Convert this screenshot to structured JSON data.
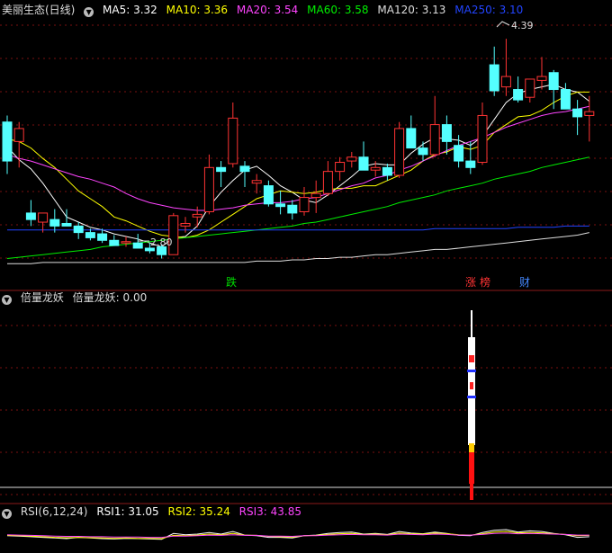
{
  "main_panel": {
    "title": "美丽生态(日线)",
    "ma": [
      {
        "label": "MA5: 3.32",
        "color": "#ffffff"
      },
      {
        "label": "MA10: 3.36",
        "color": "#ffff00"
      },
      {
        "label": "MA20: 3.54",
        "color": "#ff44ff"
      },
      {
        "label": "MA60: 3.58",
        "color": "#00ee00"
      },
      {
        "label": "MA120: 3.13",
        "color": "#dddddd"
      },
      {
        "label": "MA250: 3.10",
        "color": "#2244ff"
      }
    ],
    "high_label": "4.39",
    "low_label": "2.80",
    "events": [
      {
        "text": "跌",
        "color": "#00dd00",
        "bg": "#111111"
      },
      {
        "text": "涨",
        "color": "#ff3333",
        "bg": "#222222"
      },
      {
        "text": "榜",
        "color": "#ff3333",
        "bg": "#222222"
      },
      {
        "text": "财",
        "color": "#4488ff",
        "bg": "#111111"
      }
    ]
  },
  "mid_panel": {
    "title": "倍量龙妖",
    "value_label": "倍量龙妖: 0.00"
  },
  "rsi_panel": {
    "title": "RSI(6,12,24)",
    "rsi1_label": "RSI1: 31.05",
    "rsi2_label": "RSI2: 35.24",
    "rsi3_label": "RSI3: 43.85",
    "colors": {
      "rsi1": "#ffffff",
      "rsi2": "#ffff00",
      "rsi3": "#ff44ff"
    }
  },
  "chart_data": {
    "type": "candlestick",
    "y_range": [
      2.6,
      4.55
    ],
    "up_color": "#ff3333",
    "down_color": "#54ffff",
    "candles": [
      [
        3.75,
        3.8,
        3.35,
        3.45
      ],
      [
        3.6,
        3.75,
        3.4,
        3.7
      ],
      [
        3.05,
        3.15,
        2.95,
        3.0
      ],
      [
        2.98,
        3.05,
        2.9,
        3.05
      ],
      [
        3.0,
        3.08,
        2.9,
        2.95
      ],
      [
        2.97,
        3.08,
        2.95,
        2.95
      ],
      [
        2.95,
        2.98,
        2.85,
        2.9
      ],
      [
        2.9,
        2.93,
        2.84,
        2.86
      ],
      [
        2.89,
        2.93,
        2.82,
        2.84
      ],
      [
        2.84,
        2.88,
        2.8,
        2.8
      ],
      [
        2.82,
        2.87,
        2.79,
        2.83
      ],
      [
        2.82,
        2.89,
        2.8,
        2.78
      ],
      [
        2.78,
        2.82,
        2.74,
        2.76
      ],
      [
        2.79,
        2.81,
        2.7,
        2.73
      ],
      [
        2.73,
        3.05,
        2.73,
        3.03
      ],
      [
        2.95,
        3.02,
        2.9,
        2.97
      ],
      [
        3.02,
        3.1,
        2.94,
        3.04
      ],
      [
        3.06,
        3.5,
        3.04,
        3.4
      ],
      [
        3.4,
        3.45,
        3.25,
        3.37
      ],
      [
        3.43,
        3.9,
        3.4,
        3.78
      ],
      [
        3.41,
        3.45,
        3.25,
        3.37
      ],
      [
        3.28,
        3.35,
        3.2,
        3.3
      ],
      [
        3.26,
        3.3,
        3.1,
        3.12
      ],
      [
        3.12,
        3.22,
        3.04,
        3.1
      ],
      [
        3.11,
        3.15,
        3.0,
        3.05
      ],
      [
        3.06,
        3.25,
        3.03,
        3.17
      ],
      [
        3.17,
        3.3,
        3.05,
        3.2
      ],
      [
        3.2,
        3.45,
        3.18,
        3.37
      ],
      [
        3.37,
        3.48,
        3.3,
        3.44
      ],
      [
        3.45,
        3.52,
        3.4,
        3.48
      ],
      [
        3.48,
        3.6,
        3.4,
        3.38
      ],
      [
        3.38,
        3.45,
        3.33,
        3.4
      ],
      [
        3.4,
        3.43,
        3.3,
        3.34
      ],
      [
        3.34,
        3.75,
        3.32,
        3.7
      ],
      [
        3.7,
        3.8,
        3.6,
        3.55
      ],
      [
        3.55,
        3.6,
        3.45,
        3.5
      ],
      [
        3.5,
        3.95,
        3.48,
        3.73
      ],
      [
        3.73,
        3.8,
        3.5,
        3.6
      ],
      [
        3.57,
        3.65,
        3.4,
        3.45
      ],
      [
        3.45,
        3.6,
        3.35,
        3.4
      ],
      [
        3.44,
        3.9,
        3.42,
        3.8
      ],
      [
        4.19,
        4.33,
        3.95,
        3.99
      ],
      [
        4.02,
        4.39,
        3.95,
        4.1
      ],
      [
        4.0,
        4.1,
        3.9,
        3.92
      ],
      [
        3.94,
        4.05,
        3.9,
        4.08
      ],
      [
        4.07,
        4.25,
        4.0,
        4.1
      ],
      [
        4.13,
        4.15,
        3.85,
        4.0
      ],
      [
        4.0,
        4.05,
        3.9,
        3.85
      ],
      [
        3.85,
        3.92,
        3.65,
        3.79
      ],
      [
        3.8,
        3.95,
        3.6,
        3.83
      ]
    ],
    "ma_series": [
      {
        "name": "MA5",
        "values": [
          3.56,
          3.46,
          3.39,
          3.28,
          3.15,
          3.02,
          2.98,
          2.94,
          2.92,
          2.89,
          2.87,
          2.85,
          2.82,
          2.79,
          2.86,
          2.87,
          2.95,
          3.1,
          3.21,
          3.3,
          3.38,
          3.41,
          3.34,
          3.26,
          3.21,
          3.15,
          3.13,
          3.19,
          3.26,
          3.33,
          3.41,
          3.43,
          3.42,
          3.42,
          3.51,
          3.58,
          3.63,
          3.62,
          3.61,
          3.57,
          3.64,
          3.77,
          3.9,
          3.97,
          4.0,
          4.02,
          4.04,
          4.0,
          3.98,
          3.91
        ]
      },
      {
        "name": "MA10",
        "values": [
          3.62,
          3.6,
          3.55,
          3.47,
          3.4,
          3.31,
          3.22,
          3.16,
          3.1,
          3.02,
          2.99,
          2.95,
          2.91,
          2.88,
          2.87,
          2.86,
          2.88,
          2.92,
          2.98,
          3.04,
          3.1,
          3.16,
          3.19,
          3.22,
          3.21,
          3.2,
          3.21,
          3.23,
          3.24,
          3.24,
          3.26,
          3.26,
          3.3,
          3.34,
          3.38,
          3.45,
          3.5,
          3.52,
          3.56,
          3.54,
          3.57,
          3.67,
          3.73,
          3.79,
          3.8,
          3.84,
          3.9,
          3.95,
          3.98,
          3.98
        ]
      },
      {
        "name": "MA20",
        "values": [
          3.5,
          3.47,
          3.45,
          3.42,
          3.39,
          3.36,
          3.33,
          3.31,
          3.28,
          3.25,
          3.2,
          3.16,
          3.13,
          3.11,
          3.09,
          3.08,
          3.07,
          3.07,
          3.08,
          3.09,
          3.11,
          3.12,
          3.13,
          3.13,
          3.14,
          3.16,
          3.17,
          3.2,
          3.23,
          3.26,
          3.28,
          3.32,
          3.34,
          3.38,
          3.41,
          3.45,
          3.49,
          3.53,
          3.57,
          3.6,
          3.63,
          3.67,
          3.71,
          3.74,
          3.77,
          3.8,
          3.82,
          3.83,
          3.85,
          3.87
        ]
      },
      {
        "name": "MA60",
        "values": [
          2.7,
          2.71,
          2.72,
          2.73,
          2.74,
          2.75,
          2.76,
          2.77,
          2.79,
          2.8,
          2.81,
          2.82,
          2.83,
          2.84,
          2.85,
          2.86,
          2.87,
          2.88,
          2.89,
          2.9,
          2.91,
          2.92,
          2.93,
          2.94,
          2.95,
          2.97,
          2.98,
          3.0,
          3.02,
          3.04,
          3.06,
          3.08,
          3.1,
          3.13,
          3.15,
          3.17,
          3.19,
          3.22,
          3.24,
          3.26,
          3.28,
          3.31,
          3.33,
          3.35,
          3.37,
          3.4,
          3.42,
          3.44,
          3.46,
          3.48
        ]
      },
      {
        "name": "MA120",
        "values": [
          2.66,
          2.66,
          2.66,
          2.67,
          2.67,
          2.67,
          2.67,
          2.67,
          2.67,
          2.67,
          2.67,
          2.67,
          2.67,
          2.67,
          2.67,
          2.67,
          2.67,
          2.67,
          2.67,
          2.67,
          2.67,
          2.68,
          2.68,
          2.68,
          2.69,
          2.69,
          2.7,
          2.7,
          2.71,
          2.71,
          2.72,
          2.73,
          2.73,
          2.74,
          2.75,
          2.76,
          2.77,
          2.77,
          2.78,
          2.79,
          2.8,
          2.81,
          2.82,
          2.83,
          2.84,
          2.85,
          2.86,
          2.87,
          2.88,
          2.9
        ]
      },
      {
        "name": "MA250",
        "values": [
          2.92,
          2.92,
          2.92,
          2.92,
          2.92,
          2.92,
          2.92,
          2.92,
          2.92,
          2.92,
          2.92,
          2.92,
          2.92,
          2.92,
          2.92,
          2.92,
          2.92,
          2.92,
          2.92,
          2.92,
          2.92,
          2.92,
          2.92,
          2.92,
          2.92,
          2.92,
          2.92,
          2.92,
          2.92,
          2.92,
          2.92,
          2.92,
          2.92,
          2.92,
          2.92,
          2.92,
          2.93,
          2.93,
          2.93,
          2.93,
          2.93,
          2.93,
          2.93,
          2.94,
          2.94,
          2.94,
          2.94,
          2.95,
          2.95,
          2.95
        ]
      }
    ],
    "signal_bar": {
      "candle_index": 41,
      "value": 1
    },
    "rsi": {
      "y_range": [
        0,
        100
      ],
      "rsi1": [
        45,
        44,
        42,
        40,
        38,
        36,
        40,
        38,
        36,
        35,
        37,
        36,
        35,
        34,
        52,
        48,
        50,
        55,
        50,
        58,
        47,
        45,
        40,
        40,
        38,
        45,
        47,
        52,
        55,
        56,
        50,
        52,
        49,
        58,
        53,
        51,
        56,
        52,
        46,
        45,
        55,
        62,
        64,
        56,
        60,
        58,
        52,
        48,
        40,
        42
      ],
      "rsi2": [
        46,
        45,
        44,
        42,
        40,
        39,
        40,
        39,
        38,
        37,
        38,
        37,
        37,
        36,
        46,
        45,
        47,
        50,
        48,
        52,
        47,
        46,
        43,
        42,
        41,
        45,
        46,
        49,
        51,
        52,
        49,
        50,
        48,
        53,
        51,
        50,
        53,
        51,
        48,
        47,
        51,
        56,
        58,
        54,
        55,
        54,
        51,
        49,
        45,
        46
      ],
      "rsi3": [
        48,
        47,
        46,
        45,
        44,
        43,
        43,
        42,
        42,
        41,
        41,
        41,
        40,
        40,
        44,
        44,
        45,
        47,
        46,
        48,
        46,
        46,
        44,
        44,
        43,
        45,
        45,
        47,
        48,
        49,
        48,
        48,
        47,
        50,
        49,
        48,
        50,
        49,
        47,
        47,
        49,
        52,
        53,
        51,
        52,
        51,
        50,
        49,
        47,
        47
      ]
    }
  }
}
